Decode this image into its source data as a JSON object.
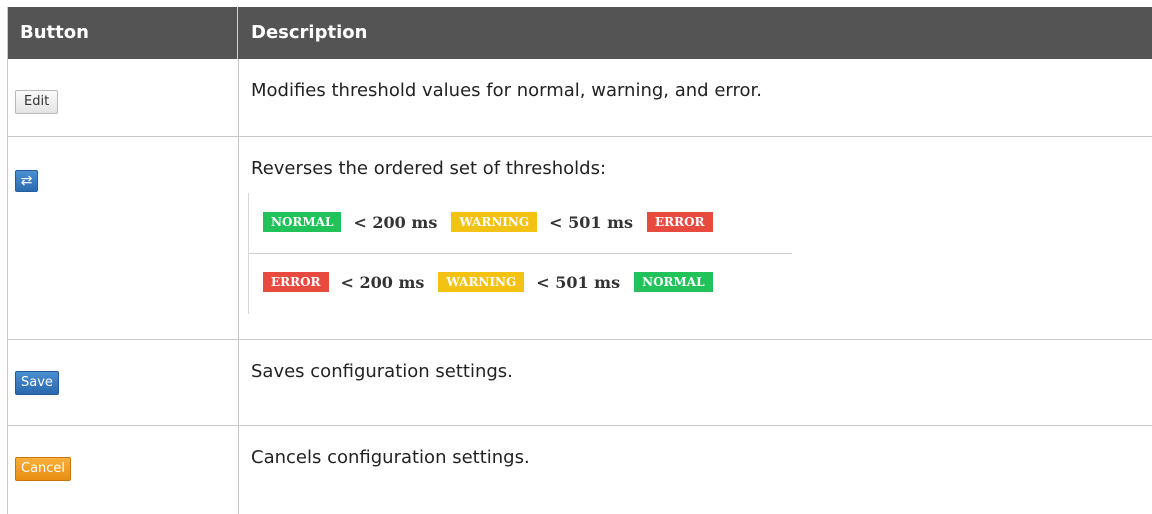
{
  "header": {
    "col1": "Button",
    "col2": "Description"
  },
  "rows": [
    {
      "button_label": "Edit",
      "description": "Modifies threshold values for normal, warning, and error."
    },
    {
      "button_label": "⇄",
      "description": "Reverses the ordered set of thresholds:"
    },
    {
      "button_label": "Save",
      "description": "Saves configuration settings."
    },
    {
      "button_label": "Cancel",
      "description": "Cancels configuration settings."
    }
  ],
  "thresholds": {
    "line1": {
      "b1": "NORMAL",
      "op1": "< 200 ms",
      "b2": "WARNING",
      "op2": "< 501 ms",
      "b3": "ERROR"
    },
    "line2": {
      "b1": "ERROR",
      "op1": "< 200 ms",
      "b2": "WARNING",
      "op2": "< 501 ms",
      "b3": "NORMAL"
    }
  },
  "colors": {
    "header_bg": "#545454",
    "normal": "#22c25a",
    "warning": "#f3c212",
    "error": "#e84a40",
    "save_blue": "#2a6bb0",
    "cancel_orange": "#f0a020"
  },
  "icons": {
    "swap": "swap-arrows-icon"
  }
}
